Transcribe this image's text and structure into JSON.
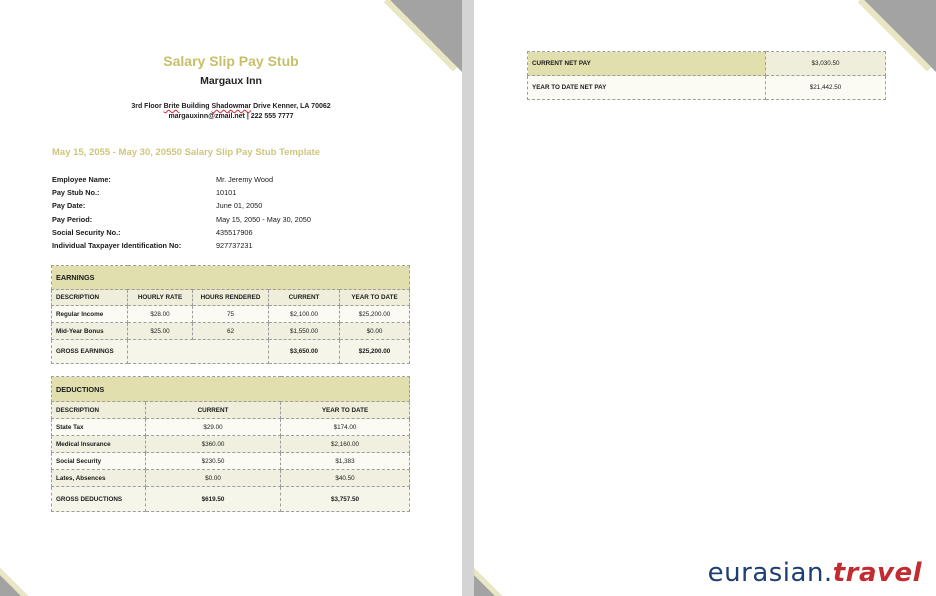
{
  "document": {
    "title": "Salary Slip Pay Stub",
    "company": "Margaux Inn",
    "address_line_1_part_1": "3rd Floor ",
    "address_line_1_word": "Brite",
    "address_line_1_part_2": " Building ",
    "address_line_1_word_2": "Shadowmar",
    "address_line_1_part_3": " Drive Kenner, LA 70062",
    "address_line_2": "margauxinn@zmail.net | 222 555 7777",
    "period_heading": "May 15, 2055 - May 30, 20550 Salary Slip Pay Stub Template"
  },
  "employee_info": [
    {
      "label": "Employee Name:",
      "value": "Mr. Jeremy Wood"
    },
    {
      "label": "Pay Stub No.:",
      "value": "10101"
    },
    {
      "label": "Pay Date:",
      "value": "June 01, 2050"
    },
    {
      "label": "Pay Period:",
      "value": "May 15, 2050 - May 30, 2050"
    },
    {
      "label": "Social Security No.:",
      "value": "435517906"
    },
    {
      "label": "Individual Taxpayer Identification No:",
      "value": "927737231"
    }
  ],
  "earnings": {
    "heading": "EARNINGS",
    "columns": [
      "DESCRIPTION",
      "HOURLY RATE",
      "HOURS RENDERED",
      "CURRENT",
      "YEAR TO DATE"
    ],
    "rows": [
      [
        "Regular Income",
        "$28.00",
        "75",
        "$2,100.00",
        "$25,200.00"
      ],
      [
        "Mid-Year Bonus",
        "$25.00",
        "62",
        "$1,550.00",
        "$0.00"
      ]
    ],
    "total": {
      "label": "GROSS EARNINGS",
      "current": "$3,650.00",
      "ytd": "$25,200.00"
    }
  },
  "deductions": {
    "heading": "DEDUCTIONS",
    "columns": [
      "DESCRIPTION",
      "CURRENT",
      "YEAR TO DATE"
    ],
    "rows": [
      [
        "State Tax",
        "$29.00",
        "$174.00"
      ],
      [
        "Medical Insurance",
        "$360.00",
        "$2,160.00"
      ],
      [
        "Social Security",
        "$230.50",
        "$1,383"
      ],
      [
        "Lates, Absences",
        "$0.00",
        "$40.50"
      ]
    ],
    "total": {
      "label": "GROSS DEDUCTIONS",
      "current": "$619.50",
      "ytd": "$3,757.50"
    }
  },
  "net_pay": {
    "current_label": "CURRENT NET PAY",
    "current_value": "$3,030.50",
    "ytd_label": "YEAR TO DATE NET PAY",
    "ytd_value": "$21,442.50"
  },
  "watermark": {
    "part1": "eurasian.",
    "part2": "travel"
  },
  "colors": {
    "accent": "#c8bf6a",
    "header_fill": "#e2dfaf",
    "watermark_blue": "#1e3f73",
    "watermark_red": "#c22c30"
  }
}
